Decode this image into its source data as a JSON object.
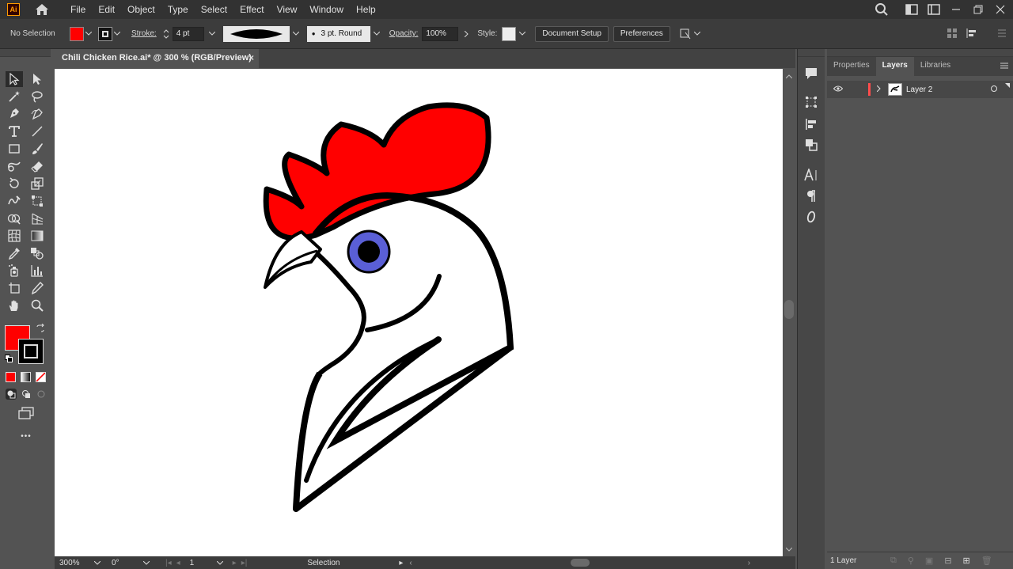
{
  "app": {
    "logo_text": "Ai"
  },
  "menu": [
    "File",
    "Edit",
    "Object",
    "Type",
    "Select",
    "Effect",
    "View",
    "Window",
    "Help"
  ],
  "control_bar": {
    "selection_status": "No Selection",
    "stroke_label": "Stroke:",
    "stroke_value": "4 pt",
    "brush_label": "3 pt. Round",
    "opacity_label": "Opacity:",
    "opacity_value": "100%",
    "style_label": "Style:",
    "document_setup": "Document Setup",
    "preferences": "Preferences",
    "fill_color": "#ff0000"
  },
  "document": {
    "tab_title": "Chili Chicken Rice.ai* @ 300 % (RGB/Preview)",
    "close": "×"
  },
  "artwork": {
    "comb_color": "#ff0000",
    "eye_color": "#5a5fd6",
    "outline_color": "#000000"
  },
  "toolbar": {
    "fill_color": "#ff0000",
    "stroke_color": "#000000",
    "more_tools": "•••"
  },
  "status_bar": {
    "zoom": "300%",
    "rotation": "0°",
    "artboard_number": "1",
    "current_tool": "Selection"
  },
  "right_panel": {
    "tabs": [
      "Properties",
      "Layers",
      "Libraries"
    ],
    "active_tab": "Layers",
    "layers": [
      {
        "name": "Layer 2",
        "color": "#ff4c4c",
        "visible": true
      }
    ],
    "layer_count": "1 Layer"
  }
}
